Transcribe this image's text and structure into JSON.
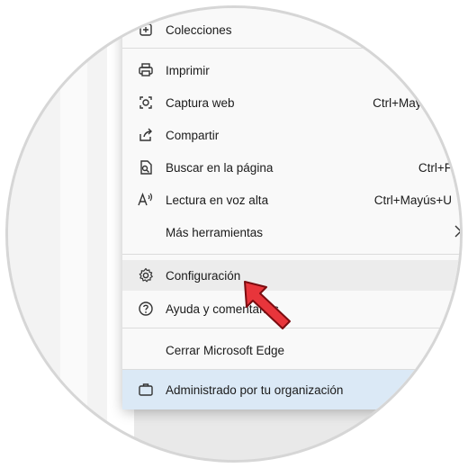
{
  "menu": {
    "items": [
      {
        "label": "Colecciones",
        "icon": "collections-icon"
      },
      {
        "label": "Imprimir",
        "icon": "print-icon"
      },
      {
        "label": "Captura web",
        "icon": "web-capture-icon",
        "shortcut": "Ctrl+Mayú"
      },
      {
        "label": "Compartir",
        "icon": "share-icon"
      },
      {
        "label": "Buscar en la página",
        "icon": "find-in-page-icon",
        "shortcut": "Ctrl+F"
      },
      {
        "label": "Lectura en voz alta",
        "icon": "read-aloud-icon",
        "shortcut": "Ctrl+Mayús+U"
      },
      {
        "label": "Más herramientas",
        "icon": "chevron-right-icon"
      },
      {
        "label": "Configuración",
        "icon": "gear-icon"
      },
      {
        "label": "Ayuda y comentarios",
        "icon": "help-icon"
      },
      {
        "label": "Cerrar Microsoft Edge"
      },
      {
        "label": "Administrado por tu organización",
        "icon": "briefcase-icon"
      }
    ]
  },
  "colors": {
    "menu_bg": "#f9f9f9",
    "highlight": "#ececec",
    "managed_bg": "#dbe9f6",
    "cursor": "#e8353b"
  }
}
